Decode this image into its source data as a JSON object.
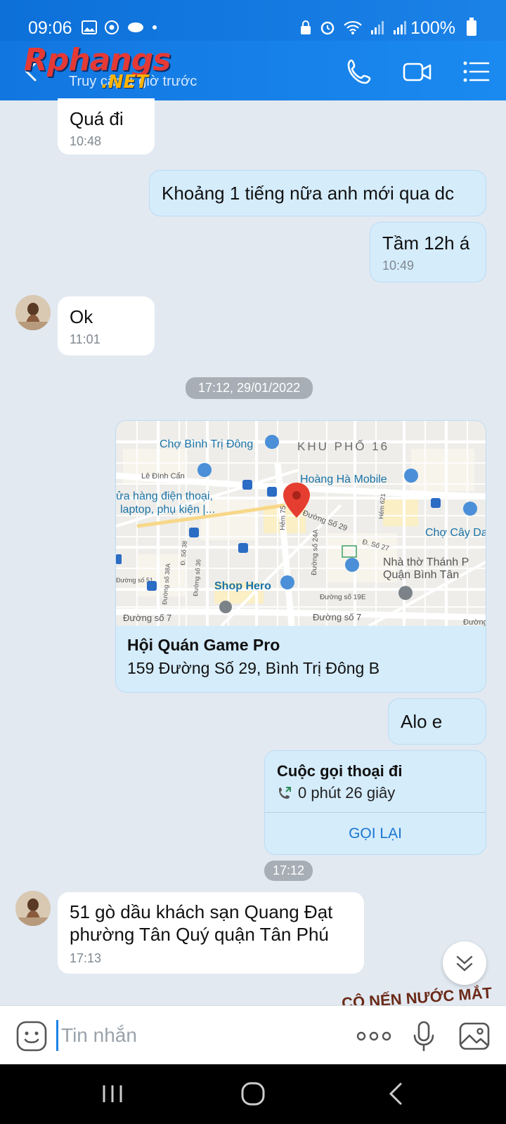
{
  "status": {
    "time": "09:06",
    "battery": "100%"
  },
  "header": {
    "logo": "Rphangs",
    "logo_net": ".NET",
    "subtitle": "Truy cập 1 giờ trước"
  },
  "messages": [
    {
      "text": "Quá đi",
      "time": "10:48"
    },
    {
      "text": "Khoảng 1 tiếng nữa anh mới qua dc"
    },
    {
      "text": "Tầm 12h á",
      "time": "10:49"
    },
    {
      "text": "Ok",
      "time": "11:01"
    },
    {
      "text": "Alo e"
    },
    {
      "text": "51 gò dầu khách sạn Quang Đạt phường Tân Quý quận Tân Phú",
      "time": "17:13"
    }
  ],
  "date_divider": "17:12, 29/01/2022",
  "location": {
    "name": "Hội Quán Game Pro",
    "address": "159 Đường Số 29, Bình Trị Đông B",
    "map_labels": {
      "market": "Chợ Bình Trị Đông",
      "area": "KHU PHỐ 16",
      "street1": "Lê Đình Cẩn",
      "shop1": "Hoàng Hà Mobile",
      "shop2_line1": "ửa hàng điện thoại,",
      "shop2_line2": "laptop, phụ kiện |...",
      "market2": "Chợ Cây Da",
      "church_line1": "Nhà thờ Thánh P",
      "church_line2": "Quận Bình Tân",
      "shop3": "Shop Hero",
      "road1": "Đường Số 29",
      "road2": "Đường số 7",
      "road3": "Đường số 7",
      "road4": "Đường số 19E",
      "road5": "Đường số 24A",
      "road6": "Hẻm 75",
      "road7": "Đ. Số 27",
      "road8": "Đường số 38A",
      "road9": "Đường số 36",
      "road10": "Đ. Số 38",
      "road11": "Hẻm 621",
      "road12": "Đường số 51",
      "road13": "Đường"
    }
  },
  "call": {
    "title": "Cuộc gọi thoại đi",
    "duration": "0 phút 26 giây",
    "action": "GỌI LẠI",
    "time": "17:12"
  },
  "sticker_text": "CÔ NẾN NƯỚC MẮT",
  "input": {
    "placeholder": "Tin nhắn"
  },
  "colors": {
    "header": "#1a80e6",
    "bubble_out": "#d5ecfb",
    "bubble_in": "#ffffff",
    "accent": "#1976d2"
  }
}
